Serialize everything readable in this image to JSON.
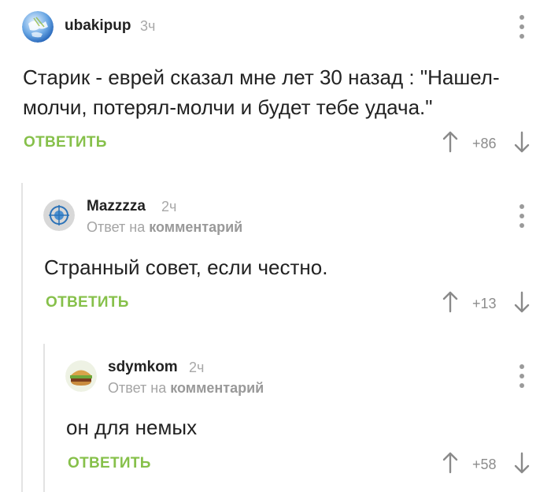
{
  "comments": [
    {
      "author": "ubakipup",
      "time": "3ч",
      "reply_to": null,
      "text_lines": [
        "Старик - еврей сказал мне лет 30 назад : \"Нашел-",
        "молчи, потерял-молчи и будет тебе удача.\""
      ],
      "reply_label": "ОТВЕТИТЬ",
      "rating": "+86",
      "avatar_icon": "globe-avatar"
    },
    {
      "author": "Mazzzza",
      "time": "2ч",
      "reply_to": {
        "prefix": "Ответ на",
        "target": "комментарий"
      },
      "text_lines": [
        "Странный совет, если честно."
      ],
      "reply_label": "ОТВЕТИТЬ",
      "rating": "+13",
      "avatar_icon": "emblem-avatar"
    },
    {
      "author": "sdymkom",
      "time": "2ч",
      "reply_to": {
        "prefix": "Ответ на",
        "target": "комментарий"
      },
      "text_lines": [
        "он для немых"
      ],
      "reply_label": "ОТВЕТИТЬ",
      "rating": "+58",
      "avatar_icon": "burger-avatar"
    }
  ],
  "colors": {
    "accent_green": "#86c04a",
    "muted_gray": "#a8a8a8",
    "thread_line": "#e3e3e3"
  }
}
